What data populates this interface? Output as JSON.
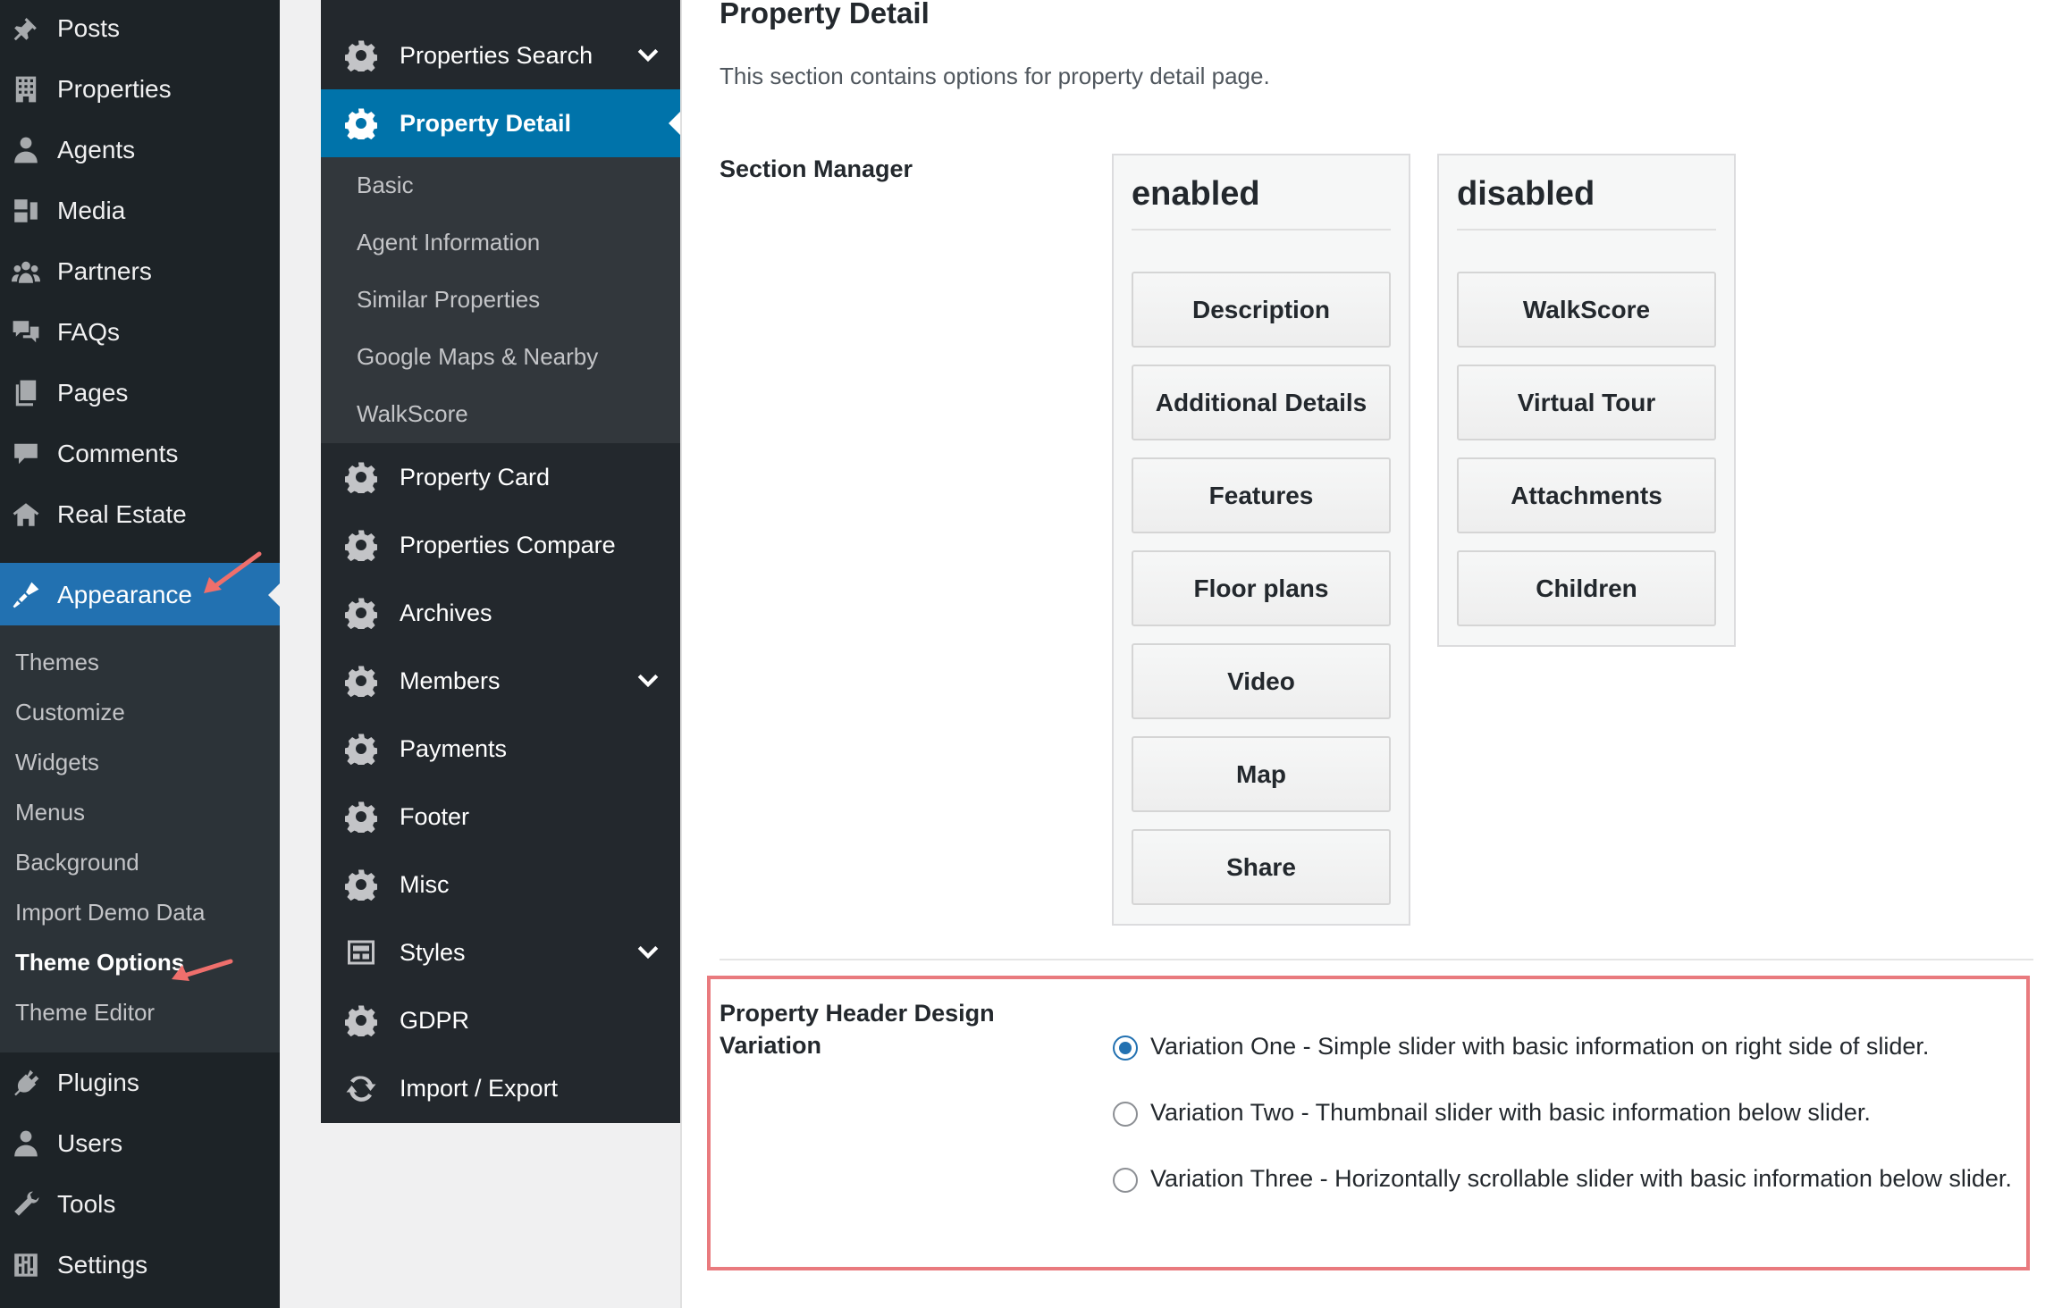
{
  "wp_menu": {
    "items": [
      {
        "label": "Posts",
        "icon": "pin-icon"
      },
      {
        "label": "Properties",
        "icon": "building-icon"
      },
      {
        "label": "Agents",
        "icon": "person-icon"
      },
      {
        "label": "Media",
        "icon": "media-icon"
      },
      {
        "label": "Partners",
        "icon": "groups-icon"
      },
      {
        "label": "FAQs",
        "icon": "comments-icon"
      },
      {
        "label": "Pages",
        "icon": "pages-icon"
      },
      {
        "label": "Comments",
        "icon": "comment-icon"
      },
      {
        "label": "Real Estate",
        "icon": "houses-icon"
      },
      {
        "label": "Appearance",
        "icon": "brush-icon"
      },
      {
        "label": "Plugins",
        "icon": "plug-icon"
      },
      {
        "label": "Users",
        "icon": "user-icon"
      },
      {
        "label": "Tools",
        "icon": "wrench-icon"
      },
      {
        "label": "Settings",
        "icon": "settings-icon"
      }
    ],
    "appearance_submenu": [
      "Themes",
      "Customize",
      "Widgets",
      "Menus",
      "Background",
      "Import Demo Data",
      "Theme Options",
      "Theme Editor"
    ]
  },
  "theme_options_nav": {
    "items": [
      {
        "label": "Properties Search",
        "has_children": true
      },
      {
        "label": "Property Detail",
        "active": true
      },
      {
        "label": "Property Card"
      },
      {
        "label": "Properties Compare"
      },
      {
        "label": "Archives"
      },
      {
        "label": "Members",
        "has_children": true
      },
      {
        "label": "Payments"
      },
      {
        "label": "Footer"
      },
      {
        "label": "Misc"
      },
      {
        "label": "Styles",
        "has_children": true
      },
      {
        "label": "GDPR"
      },
      {
        "label": "Import / Export"
      }
    ],
    "property_detail_sub": [
      "Basic",
      "Agent Information",
      "Similar Properties",
      "Google Maps & Nearby",
      "WalkScore"
    ]
  },
  "main": {
    "title": "Property Detail",
    "description": "This section contains options for property detail page.",
    "section_manager": {
      "label": "Section Manager",
      "enabled_title": "enabled",
      "disabled_title": "disabled",
      "enabled": [
        "Description",
        "Additional Details",
        "Features",
        "Floor plans",
        "Video",
        "Map",
        "Share"
      ],
      "disabled": [
        "WalkScore",
        "Virtual Tour",
        "Attachments",
        "Children"
      ]
    },
    "header_variation": {
      "label": "Property Header Design Variation",
      "options": [
        {
          "label": "Variation One - Simple slider with basic information on right side of slider.",
          "checked": true
        },
        {
          "label": "Variation Two - Thumbnail slider with basic information below slider.",
          "checked": false
        },
        {
          "label": "Variation Three - Horizontally scrollable slider with basic information below slider.",
          "checked": false
        }
      ]
    }
  },
  "colors": {
    "admin_bg": "#1d2327",
    "accent": "#2271b1",
    "highlight_border": "#e97a7e"
  }
}
